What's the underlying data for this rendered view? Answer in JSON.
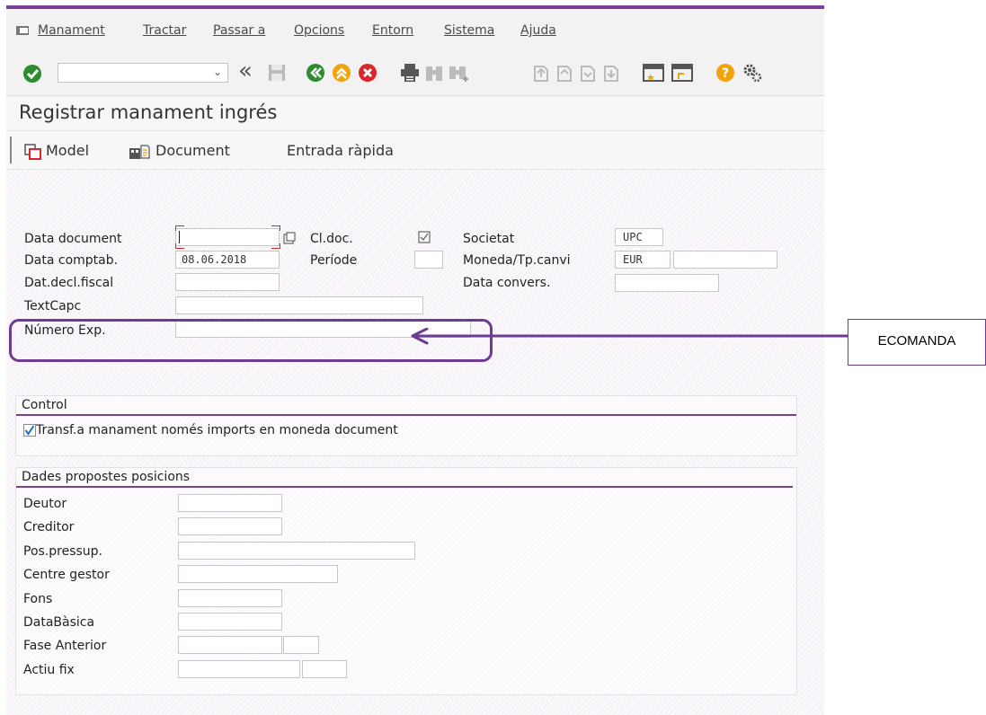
{
  "menubar": {
    "items": [
      "Manament",
      "Tractar",
      "Passar a",
      "Opcions",
      "Entorn",
      "Sistema",
      "Ajuda"
    ]
  },
  "toolbar": {
    "icons": [
      "enter-check-icon",
      "command-field-dropdown",
      "back-history-icon",
      "save-icon",
      "back-icon",
      "exit-icon",
      "cancel-icon",
      "print-icon",
      "find-icon",
      "find-next-icon",
      "first-page-icon",
      "previous-page-icon",
      "next-page-icon",
      "last-page-icon",
      "create-session-icon",
      "shortcut-icon",
      "help-icon",
      "customize-layout-icon"
    ]
  },
  "title": "Registrar manament ingrés",
  "app_toolbar": {
    "model_label": "Model",
    "document_label": "Document",
    "quick_entry_label": "Entrada ràpida"
  },
  "header": {
    "data_document_label": "Data document",
    "data_document_value": "",
    "data_comptab_label": "Data comptab.",
    "data_comptab_value": "08.06.2018",
    "dat_decl_fiscal_label": "Dat.decl.fiscal",
    "textcapc_label": "TextCapc",
    "numero_exp_label": "Número Exp.",
    "cl_doc_label": "Cl.doc.",
    "periode_label": "Període",
    "societat_label": "Societat",
    "societat_value": "UPC",
    "moneda_label": "Moneda/Tp.canvi",
    "moneda_value": "EUR",
    "data_convers_label": "Data convers."
  },
  "control": {
    "title": "Control",
    "checkbox_label": "Transf.a manament només imports en moneda document",
    "checked": true
  },
  "positions": {
    "title": "Dades propostes posicions",
    "fields": [
      "Deutor",
      "Creditor",
      "Pos.pressup.",
      "Centre gestor",
      "Fons",
      "DataBàsica",
      "Fase Anterior",
      "Actiu fix"
    ]
  },
  "annotation": {
    "label": "ECOMANDA",
    "color": "#6e3a94"
  },
  "colors": {
    "accent": "#7a3f96",
    "green": "#2e8b2e",
    "orange": "#f0a30a",
    "red": "#d9262c"
  }
}
